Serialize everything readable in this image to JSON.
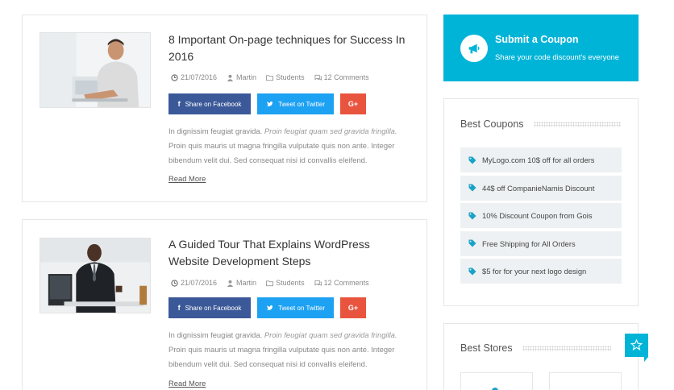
{
  "posts": [
    {
      "title": "8 Important On-page techniques for Success In 2016",
      "date": "21/07/2016",
      "author": "Martin",
      "category": "Students",
      "comments": "12 Comments",
      "share_facebook": "Share on Facebook",
      "share_twitter": "Tweet on Twitter",
      "share_google": "G+",
      "excerpt_start": "In dignissim feugiat gravida. ",
      "excerpt_italic": "Proin feugiat quam sed gravida fringilla.",
      "excerpt_end": " Proin quis mauris ut magna fringilla vulputate quis non ante. Integer bibendum velit dui. Sed consequat nisi id convallis eleifend.",
      "read_more": "Read More"
    },
    {
      "title": "A Guided Tour That Explains WordPress Website Development Steps",
      "date": "21/07/2016",
      "author": "Martin",
      "category": "Students",
      "comments": "12 Comments",
      "share_facebook": "Share on Facebook",
      "share_twitter": "Tweet on Twitter",
      "share_google": "G+",
      "excerpt_start": "In dignissim feugiat gravida. ",
      "excerpt_italic": "Proin feugiat quam sed gravida fringilla.",
      "excerpt_end": " Proin quis mauris ut magna fringilla vulputate quis non ante. Integer bibendum velit dui. Sed consequat nisi id convallis eleifend.",
      "read_more": "Read More"
    }
  ],
  "submit_coupon": {
    "title": "Submit a Coupon",
    "subtitle": "Share your code discount's everyone",
    "icon": "megaphone-icon"
  },
  "best_coupons": {
    "title": "Best Coupons",
    "items": [
      "MyLogo.com 10$ off for all orders",
      "44$ off CompanieNamis Discount",
      "10% Discount Coupon from Gois",
      "Free Shipping for All Orders",
      "$5 for for your next logo design"
    ]
  },
  "best_stores": {
    "title": "Best Stores"
  },
  "colors": {
    "accent": "#00b4d8",
    "facebook": "#3b5998",
    "twitter": "#1da1f2",
    "google": "#e9543f",
    "tag_icon": "#1aa3c8"
  }
}
